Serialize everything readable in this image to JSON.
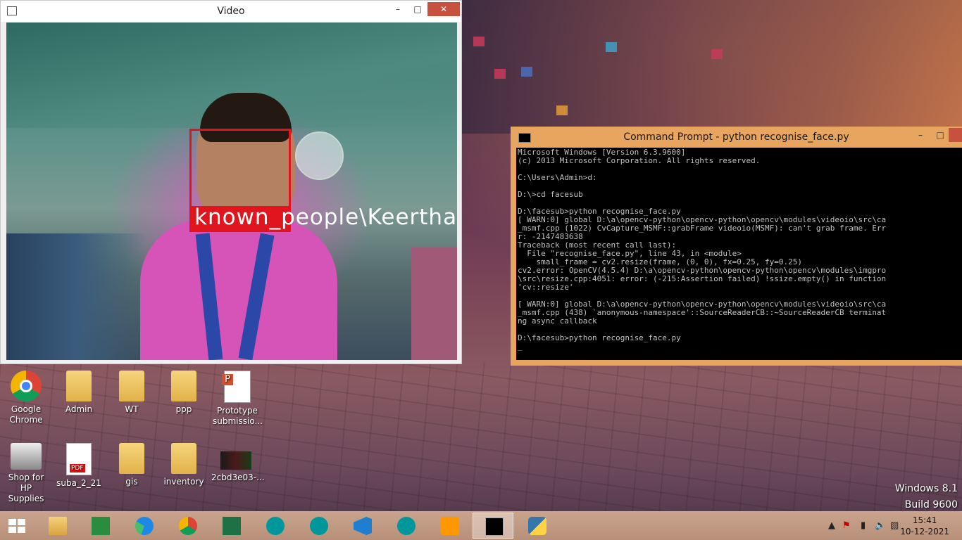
{
  "video_window": {
    "title": "Video",
    "controls": {
      "minimize": "–",
      "maximize": "□",
      "close": "✕"
    },
    "face_label": "known_people\\Keerthana"
  },
  "cmd_window": {
    "title": "Command Prompt - python  recognise_face.py",
    "controls": {
      "minimize": "–",
      "maximize": "□",
      "close": ""
    },
    "lines": [
      "Microsoft Windows [Version 6.3.9600]",
      "(c) 2013 Microsoft Corporation. All rights reserved.",
      "",
      "C:\\Users\\Admin>d:",
      "",
      "D:\\>cd facesub",
      "",
      "D:\\facesub>python recognise_face.py",
      "[ WARN:0] global D:\\a\\opencv-python\\opencv-python\\opencv\\modules\\videoio\\src\\ca",
      "_msmf.cpp (1022) CvCapture_MSMF::grabFrame videoio(MSMF): can't grab frame. Err",
      "r: -2147483638",
      "Traceback (most recent call last):",
      "  File \"recognise_face.py\", line 43, in <module>",
      "    small_frame = cv2.resize(frame, (0, 0), fx=0.25, fy=0.25)",
      "cv2.error: OpenCV(4.5.4) D:\\a\\opencv-python\\opencv-python\\opencv\\modules\\imgpro",
      "\\src\\resize.cpp:4051: error: (-215:Assertion failed) !ssize.empty() in function",
      "'cv::resize'",
      "",
      "[ WARN:0] global D:\\a\\opencv-python\\opencv-python\\opencv\\modules\\videoio\\src\\ca",
      "_msmf.cpp (438) `anonymous-namespace'::SourceReaderCB::~SourceReaderCB terminat",
      "ng async callback",
      "",
      "D:\\facesub>python recognise_face.py",
      "_"
    ]
  },
  "desktop_icons": [
    {
      "label": "Google Chrome",
      "icon": "chrome-icon"
    },
    {
      "label": "Admin",
      "icon": "user-folder-icon"
    },
    {
      "label": "WT",
      "icon": "folder-icon"
    },
    {
      "label": "ppp",
      "icon": "folder-icon"
    },
    {
      "label": "Prototype submissio...",
      "icon": "powerpoint-doc-icon"
    },
    {
      "label": "Shop for HP Supplies",
      "icon": "printer-icon"
    },
    {
      "label": "suba_2_21",
      "icon": "pdf-icon"
    },
    {
      "label": "gis",
      "icon": "folder-icon"
    },
    {
      "label": "inventory",
      "icon": "folder-icon"
    },
    {
      "label": "2cbd3e03-...",
      "icon": "video-thumbnail-icon"
    }
  ],
  "watermark": {
    "line1": "Windows 8.1",
    "line2": "Build 9600"
  },
  "taskbar": {
    "pinned": [
      {
        "name": "file-explorer",
        "icon": "folder-icon"
      },
      {
        "name": "store",
        "icon": "store-icon"
      },
      {
        "name": "edge",
        "icon": "edge-icon"
      },
      {
        "name": "chrome",
        "icon": "chrome-icon"
      },
      {
        "name": "excel",
        "icon": "excel-icon"
      },
      {
        "name": "arduino-1",
        "icon": "arduino-icon"
      },
      {
        "name": "arduino-2",
        "icon": "arduino-icon"
      },
      {
        "name": "vscode",
        "icon": "vscode-icon"
      },
      {
        "name": "arduino-3",
        "icon": "arduino-icon"
      },
      {
        "name": "sublime",
        "icon": "sublime-icon"
      },
      {
        "name": "command-prompt",
        "icon": "cmd-icon"
      },
      {
        "name": "python",
        "icon": "python-icon"
      }
    ],
    "clock_time": "15:41",
    "clock_date": "10-12-2021"
  }
}
